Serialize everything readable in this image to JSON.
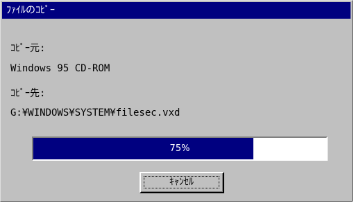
{
  "window": {
    "title": "ﾌｧｲﾙのｺﾋﾟｰ"
  },
  "copy": {
    "from_label": "ｺﾋﾟｰ元:",
    "from_value": "Windows 95 CD-ROM",
    "to_label": "ｺﾋﾟｰ先:",
    "to_value": "G:¥WINDOWS¥SYSTEM¥filesec.vxd"
  },
  "progress": {
    "percent": 75,
    "text": "75%",
    "fill_color": "#000080"
  },
  "buttons": {
    "cancel_label": "ｷｬﾝｾﾙ"
  }
}
